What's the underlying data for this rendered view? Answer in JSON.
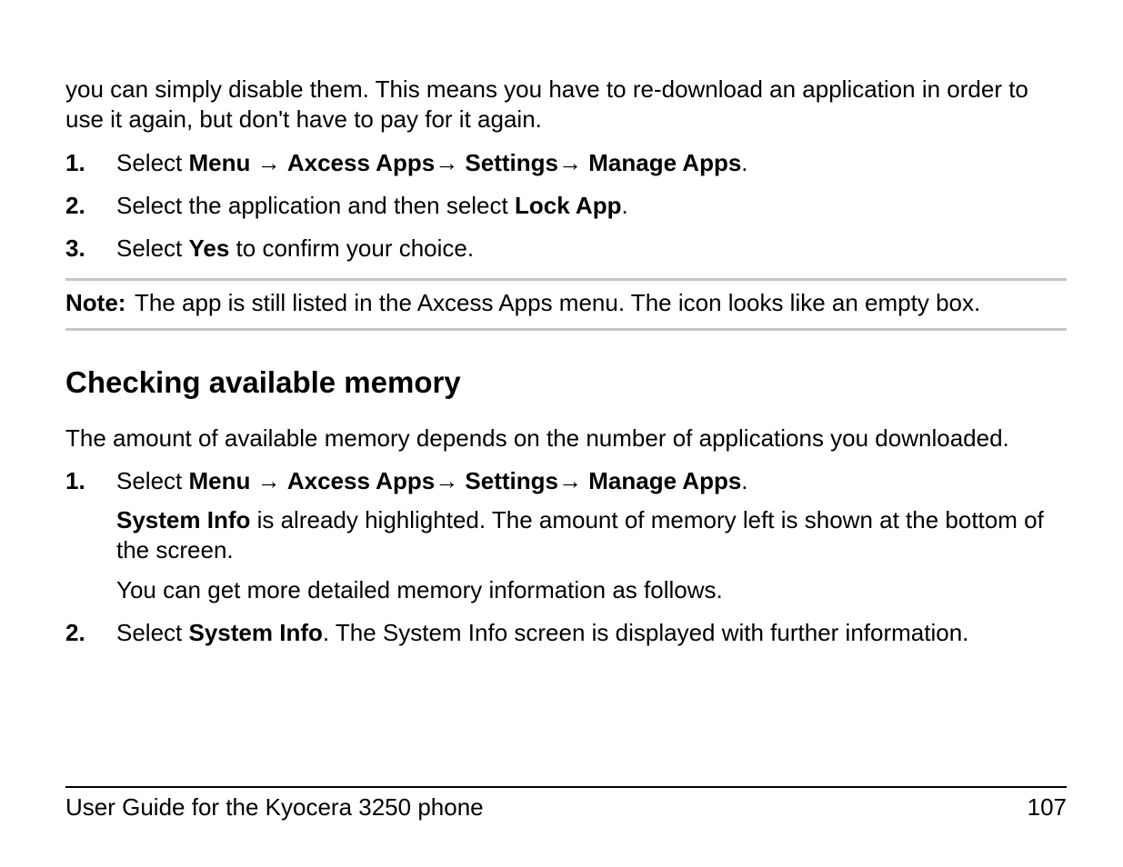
{
  "intro": "you can simply disable them. This means you have to re-download an application in order to use it again, but don't have to pay for it again.",
  "list1": {
    "items": [
      {
        "num": "1.",
        "prefix": "Select ",
        "path": [
          {
            "label": "Menu",
            "arrow": " → "
          },
          {
            "label": "Axcess Apps",
            "arrow": "→ "
          },
          {
            "label": "Settings",
            "arrow": "→ "
          },
          {
            "label": "Manage Apps",
            "arrow": ""
          }
        ],
        "suffix": "."
      },
      {
        "num": "2.",
        "pre": "Select the application and then select ",
        "bold": "Lock App",
        "post": "."
      },
      {
        "num": "3.",
        "pre": "Select ",
        "bold": "Yes",
        "post": " to confirm your choice."
      }
    ]
  },
  "note": {
    "label": "Note:",
    "text": "The app is still listed in the Axcess Apps menu. The icon looks like an empty box."
  },
  "heading": "Checking available memory",
  "para2": "The amount of available memory depends on the number of applications you downloaded.",
  "list2": {
    "items": [
      {
        "num": "1.",
        "line1_prefix": "Select ",
        "path": [
          {
            "label": "Menu",
            "arrow": " → "
          },
          {
            "label": "Axcess Apps",
            "arrow": "→ "
          },
          {
            "label": "Settings",
            "arrow": "→ "
          },
          {
            "label": "Manage Apps",
            "arrow": ""
          }
        ],
        "line1_suffix": ".",
        "line2_bold": "System Info",
        "line2_rest": " is already highlighted. The amount of memory left is shown at the bottom of the screen.",
        "line3": "You can get more detailed memory information as follows."
      },
      {
        "num": "2.",
        "pre": "Select ",
        "bold": "System Info",
        "post": ". The System Info screen is displayed with further information."
      }
    ]
  },
  "footer": {
    "left": "User Guide for the Kyocera 3250 phone",
    "right": "107"
  }
}
